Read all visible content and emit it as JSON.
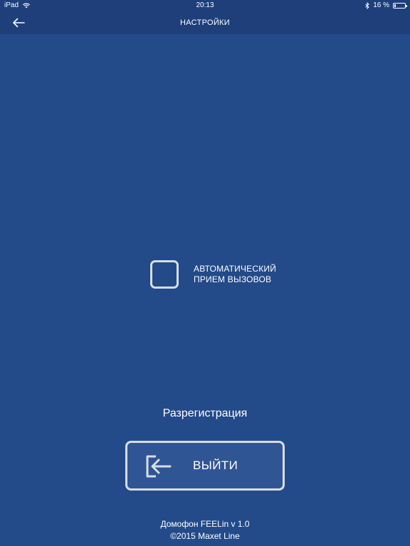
{
  "status_bar": {
    "device": "iPad",
    "time": "20:13",
    "battery_text": "16 %",
    "battery_level": 0.16,
    "icons": [
      "wifi-icon",
      "bluetooth-icon",
      "battery-icon"
    ]
  },
  "nav": {
    "title": "НАСТРОЙКИ",
    "back_icon": "arrow-left-icon"
  },
  "auto_answer": {
    "line1": "АВТОМАТИЧЕСКИЙ",
    "line2": "ПРИЕМ ВЫЗОВОВ",
    "checked": false
  },
  "deregistration": {
    "title": "Разрегистрация",
    "button_label": "ВЫЙТИ",
    "button_icon": "logout-icon"
  },
  "footer": {
    "version": "Домофон FEELin v 1.0",
    "copyright": "©2015 Maxet Line"
  },
  "colors": {
    "background": "#234a89",
    "bar": "#1e3f7a",
    "button_fill": "#2f5594",
    "outline": "#d8dde8",
    "text": "#ffffff"
  }
}
